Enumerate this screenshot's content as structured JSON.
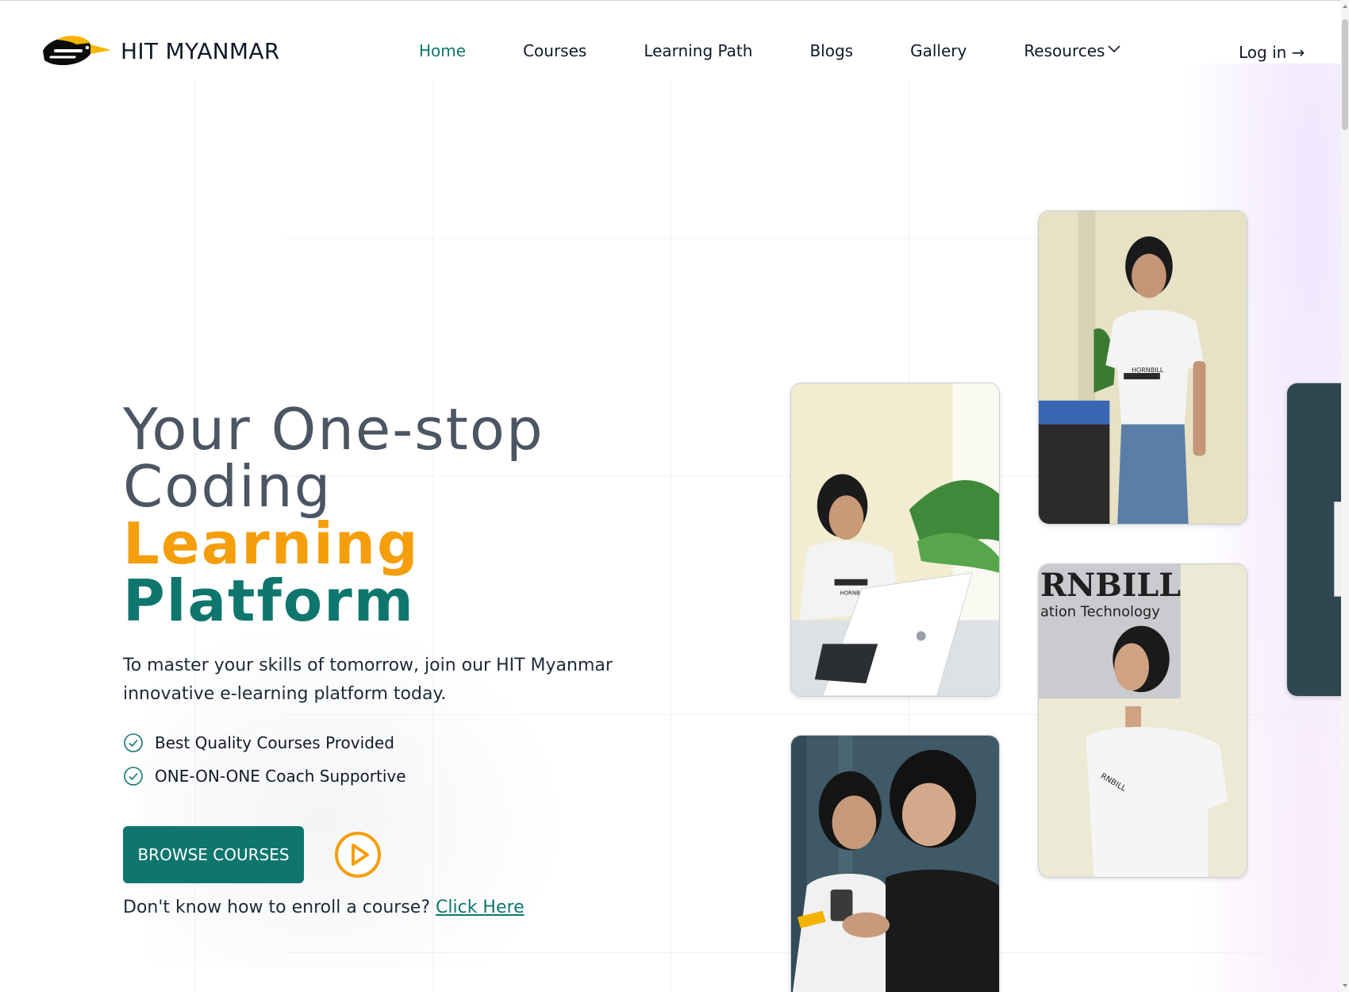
{
  "brand": {
    "name": "HIT MYANMAR",
    "logo_icon": "hornbill-logo-icon"
  },
  "nav": {
    "items": [
      {
        "label": "Home",
        "active": true
      },
      {
        "label": "Courses",
        "active": false
      },
      {
        "label": "Learning Path",
        "active": false
      },
      {
        "label": "Blogs",
        "active": false
      },
      {
        "label": "Gallery",
        "active": false
      },
      {
        "label": "Resources",
        "active": false,
        "icon": "chevron-down-icon"
      }
    ],
    "login": "Log in →"
  },
  "hero": {
    "title_part1": "Your One-stop",
    "title_part2": "Coding ",
    "title_highlight_orange": "Learning",
    "title_highlight_teal": "Platform",
    "description": "To master your skills of tomorrow, join our HIT Myanmar innovative e-learning platform today.",
    "features": [
      "Best Quality Courses Provided",
      "ONE-ON-ONE Coach Supportive"
    ],
    "browse_button": "BROWSE COURSES",
    "play_icon": "play-circle-icon",
    "enroll_text": "Don't know how to enroll a course? ",
    "enroll_link": "Click Here"
  },
  "photos": {
    "p1_sign": "HORNBILL",
    "p3_sign": "HORNBILL",
    "p4_sign_top": "RNBILL",
    "p4_sign_bottom": "ation Technology",
    "p4_shirt": "RNBILL"
  },
  "colors": {
    "accent_teal": "#0f766e",
    "accent_orange": "#f59e0b",
    "title_gray": "#4b5563"
  }
}
